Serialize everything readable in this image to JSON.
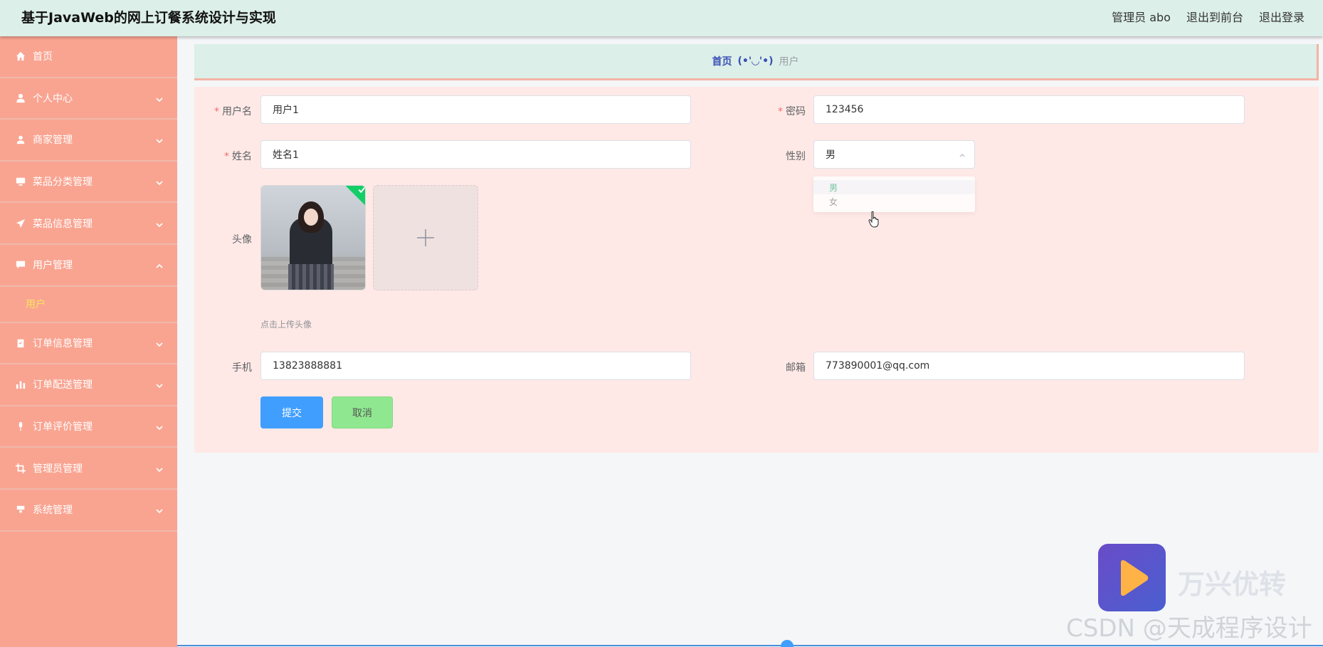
{
  "header": {
    "title": "基于JavaWeb的网上订餐系统设计与实现",
    "admin_label": "管理员 abo",
    "to_front": "退出到前台",
    "logout": "退出登录"
  },
  "sidebar": {
    "items": [
      {
        "label": "首页",
        "icon": "home-icon"
      },
      {
        "label": "个人中心",
        "icon": "user-icon"
      },
      {
        "label": "商家管理",
        "icon": "person-icon"
      },
      {
        "label": "菜品分类管理",
        "icon": "monitor-icon"
      },
      {
        "label": "菜品信息管理",
        "icon": "send-icon"
      },
      {
        "label": "用户管理",
        "icon": "message-icon"
      },
      {
        "label": "订单信息管理",
        "icon": "clipboard-icon"
      },
      {
        "label": "订单配送管理",
        "icon": "bar-chart-icon"
      },
      {
        "label": "订单评价管理",
        "icon": "microphone-icon"
      },
      {
        "label": "管理员管理",
        "icon": "crop-icon"
      },
      {
        "label": "系统管理",
        "icon": "cup-icon"
      }
    ],
    "submenu_user": "用户"
  },
  "breadcrumb": {
    "home": "首页",
    "separator": "(•'◡'•)",
    "current": "用户"
  },
  "form": {
    "username_label": "用户名",
    "username_value": "用户1",
    "password_label": "密码",
    "password_value": "123456",
    "name_label": "姓名",
    "name_value": "姓名1",
    "gender_label": "性别",
    "gender_value": "男",
    "gender_options": [
      "男",
      "女"
    ],
    "avatar_label": "头像",
    "avatar_hint": "点击上传头像",
    "phone_label": "手机",
    "phone_value": "13823888881",
    "email_label": "邮箱",
    "email_value": "773890001@qq.com",
    "submit": "提交",
    "cancel": "取消"
  },
  "watermark": {
    "brand": "万兴优转",
    "csdn": "CSDN @天成程序设计"
  },
  "colors": {
    "header_bg": "#dcefe8",
    "sidebar_bg": "#f9a491",
    "panel_bg": "#ffe9e6",
    "submit_bg": "#409eff",
    "cancel_bg": "#8fe88f",
    "submenu_active": "#f9e35d"
  }
}
